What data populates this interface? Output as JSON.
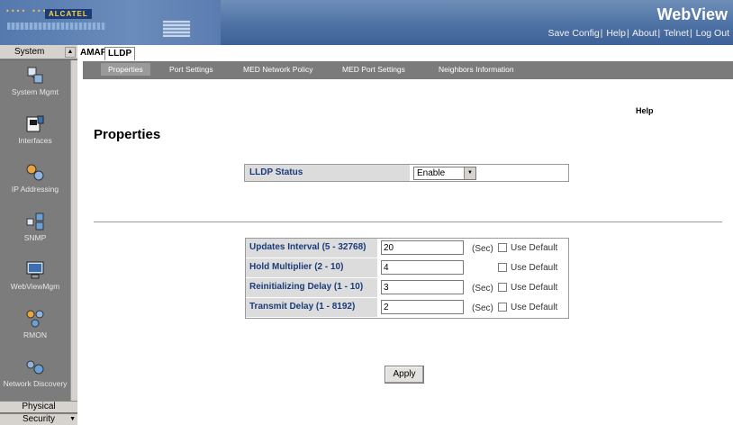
{
  "header": {
    "brand": "WebView",
    "logo_text": "ALCATEL",
    "links": [
      "Save Config",
      "Help",
      "About",
      "Telnet",
      "Log Out"
    ],
    "accent": "#4f72a5"
  },
  "sidebar": {
    "group_title": "System",
    "items": [
      {
        "label": "System Mgmt",
        "icon": "system-mgmt-icon"
      },
      {
        "label": "Interfaces",
        "icon": "interfaces-icon"
      },
      {
        "label": "IP Addressing",
        "icon": "ip-addressing-icon"
      },
      {
        "label": "SNMP",
        "icon": "snmp-icon"
      },
      {
        "label": "WebViewMgm",
        "icon": "webview-mgmt-icon"
      },
      {
        "label": "RMON",
        "icon": "rmon-icon"
      },
      {
        "label": "Network Discovery",
        "icon": "network-discovery-icon"
      }
    ],
    "bottom_groups": [
      "Physical",
      "Security"
    ]
  },
  "tabs": {
    "amap": "AMAP",
    "lldp": "LLDP"
  },
  "subnav": {
    "items": [
      "Properties",
      "Port Settings",
      "MED Network Policy",
      "MED Port Settings",
      "Neighbors Information"
    ],
    "active": "Properties"
  },
  "main": {
    "help": "Help",
    "title": "Properties",
    "lldp_status": {
      "label": "LLDP Status",
      "value": "Enable"
    },
    "rows": [
      {
        "label": "Updates Interval (5 - 32768)",
        "value": "20",
        "unit": "(Sec)",
        "default_label": "Use Default",
        "checked": false
      },
      {
        "label": "Hold Multiplier (2 - 10)",
        "value": "4",
        "unit": "",
        "default_label": "Use Default",
        "checked": false
      },
      {
        "label": "Reinitializing Delay (1 - 10)",
        "value": "3",
        "unit": "(Sec)",
        "default_label": "Use Default",
        "checked": false
      },
      {
        "label": "Transmit Delay (1 - 8192)",
        "value": "2",
        "unit": "(Sec)",
        "default_label": "Use Default",
        "checked": false
      }
    ],
    "apply": "Apply"
  }
}
